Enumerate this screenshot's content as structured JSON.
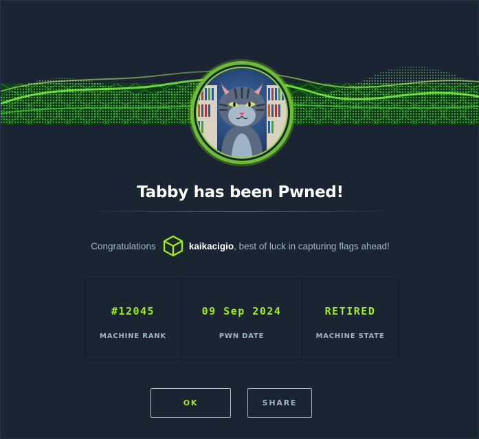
{
  "modal": {
    "title": "Tabby has been Pwned!",
    "congrats": {
      "lead": "Congratulations",
      "username": "kaikacigio",
      "trail": ", best of luck in capturing flags ahead!"
    },
    "stats": [
      {
        "value": "#12045",
        "label": "MACHINE RANK"
      },
      {
        "value": "09 Sep 2024",
        "label": "PWN DATE"
      },
      {
        "value": "RETIRED",
        "label": "MACHINE STATE"
      }
    ],
    "buttons": {
      "ok_label": "OK",
      "share_label": "SHARE"
    }
  },
  "colors": {
    "accent": "#9fef00",
    "background": "#1b2433",
    "muted_text": "#a4b1cd"
  },
  "icons": {
    "avatar": "tabby-cat-avatar",
    "user_badge": "htb-cube-icon",
    "banner": "green-wave-banner"
  }
}
